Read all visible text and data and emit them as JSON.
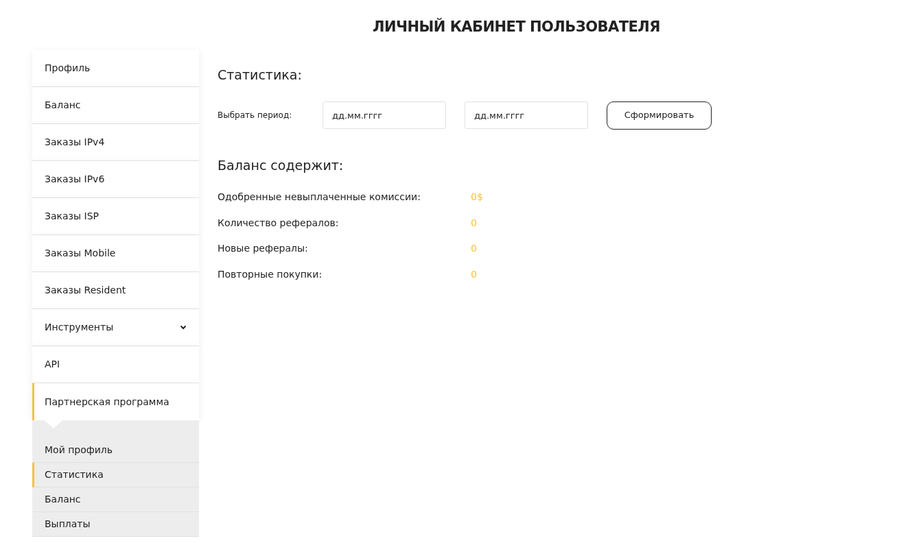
{
  "page_title": "ЛИЧНЫЙ КАБИНЕТ ПОЛЬЗОВАТЕЛЯ",
  "sidebar": {
    "items": [
      {
        "label": "Профиль",
        "selected": false
      },
      {
        "label": "Баланс",
        "selected": false
      },
      {
        "label": "Заказы IPv4",
        "selected": false
      },
      {
        "label": "Заказы IPv6",
        "selected": false
      },
      {
        "label": "Заказы ISP",
        "selected": false
      },
      {
        "label": "Заказы Mobile",
        "selected": false
      },
      {
        "label": "Заказы Resident",
        "selected": false
      },
      {
        "label": "Инструменты",
        "selected": false,
        "expanded": false,
        "has_children": true
      },
      {
        "label": "API",
        "selected": false
      },
      {
        "label": "Партнерская программа",
        "selected": true,
        "expanded": true,
        "children": [
          {
            "label": "Мой профиль",
            "selected": false
          },
          {
            "label": "Статистика",
            "selected": true
          },
          {
            "label": "Баланс",
            "selected": false
          },
          {
            "label": "Выплаты",
            "selected": false
          }
        ]
      }
    ]
  },
  "statistics": {
    "title": "Статистика:",
    "period_label": "Выбрать период:",
    "date_from": {
      "placeholder": "дд.мм.гггг"
    },
    "date_to": {
      "placeholder": "дд.мм.гггг"
    },
    "button": "Сформировать"
  },
  "balance": {
    "title": "Баланс содержит:",
    "rows": [
      {
        "label": "Одобренные невыплаченные комиссии:",
        "value": "0$"
      },
      {
        "label": "Количество рефералов:",
        "value": "0"
      },
      {
        "label": "Новые рефералы:",
        "value": "0"
      },
      {
        "label": "Повторные покупки:",
        "value": "0"
      }
    ]
  }
}
